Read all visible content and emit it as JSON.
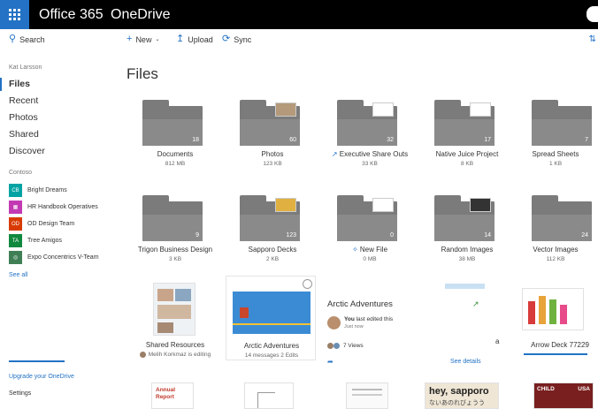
{
  "header": {
    "brand": "Office 365",
    "app_name": "OneDrive"
  },
  "toolbar": {
    "search_label": "Search",
    "new_label": "New",
    "upload_label": "Upload",
    "sync_label": "Sync"
  },
  "sidebar": {
    "user_name": "Kat Larsson",
    "nav": [
      {
        "label": "Files",
        "active": true
      },
      {
        "label": "Recent",
        "active": false
      },
      {
        "label": "Photos",
        "active": false
      },
      {
        "label": "Shared",
        "active": false
      },
      {
        "label": "Discover",
        "active": false
      }
    ],
    "section_label": "Contoso",
    "groups": [
      {
        "initials": "CB",
        "label": "Bright Dreams",
        "color": "#00a3a3"
      },
      {
        "initials": "",
        "label": "HR Handbook Operatives",
        "color": "#c239b3"
      },
      {
        "initials": "OD",
        "label": "OD Design Team",
        "color": "#d83b01"
      },
      {
        "initials": "TA",
        "label": "Tree Amigos",
        "color": "#10893e"
      },
      {
        "initials": "",
        "label": "Expo Concentrics V-Team",
        "color": "#407f55"
      }
    ],
    "see_all": "See all",
    "upgrade": "Upgrade your OneDrive",
    "settings": "Settings"
  },
  "main": {
    "title": "Files",
    "folders_row1": [
      {
        "name": "Documents",
        "size": "812 MB",
        "count": "18"
      },
      {
        "name": "Photos",
        "size": "123 KB",
        "count": "60"
      },
      {
        "name": "Executive Share Outs",
        "size": "33 KB",
        "count": "32"
      },
      {
        "name": "Native Juice Project",
        "size": "8 KB",
        "count": "17"
      },
      {
        "name": "Spread Sheets",
        "size": "1 KB",
        "count": "7"
      }
    ],
    "folders_row2": [
      {
        "name": "Trigon Business Design",
        "size": "3 KB",
        "count": "9"
      },
      {
        "name": "Sapporo Decks",
        "size": "2 KB",
        "count": "123"
      },
      {
        "name": "New File",
        "size": "0 MB",
        "count": "0"
      },
      {
        "name": "Random Images",
        "size": "38 MB",
        "count": "14"
      },
      {
        "name": "Vector Images",
        "size": "112 KB",
        "count": "24"
      }
    ],
    "row3": {
      "shared_resources": {
        "name": "Shared Resources",
        "status": "Melih Korkmaz is editing"
      },
      "arctic_tile": {
        "name": "Arctic Adventures",
        "sub": "14 messages 2 Edits"
      },
      "arctic_card": {
        "title": "Arctic Adventures",
        "you_label": "You",
        "edited": "last edited this",
        "time": "Just now",
        "views": "7 Views",
        "see_details": "See details"
      },
      "truncated_label": "a",
      "arrow_deck": {
        "name": "Arrow Deck 77229"
      }
    },
    "row4": {
      "annual_report": "Annual Report",
      "sapporo_text": "hey, sapporo",
      "sapporo_jp": "ないあのれびょうう",
      "child_text": "CHILD",
      "usa_text": "USA"
    }
  },
  "colors": {
    "accent": "#2372c5",
    "topbar": "#000000",
    "folder": "#7b7b7b"
  }
}
